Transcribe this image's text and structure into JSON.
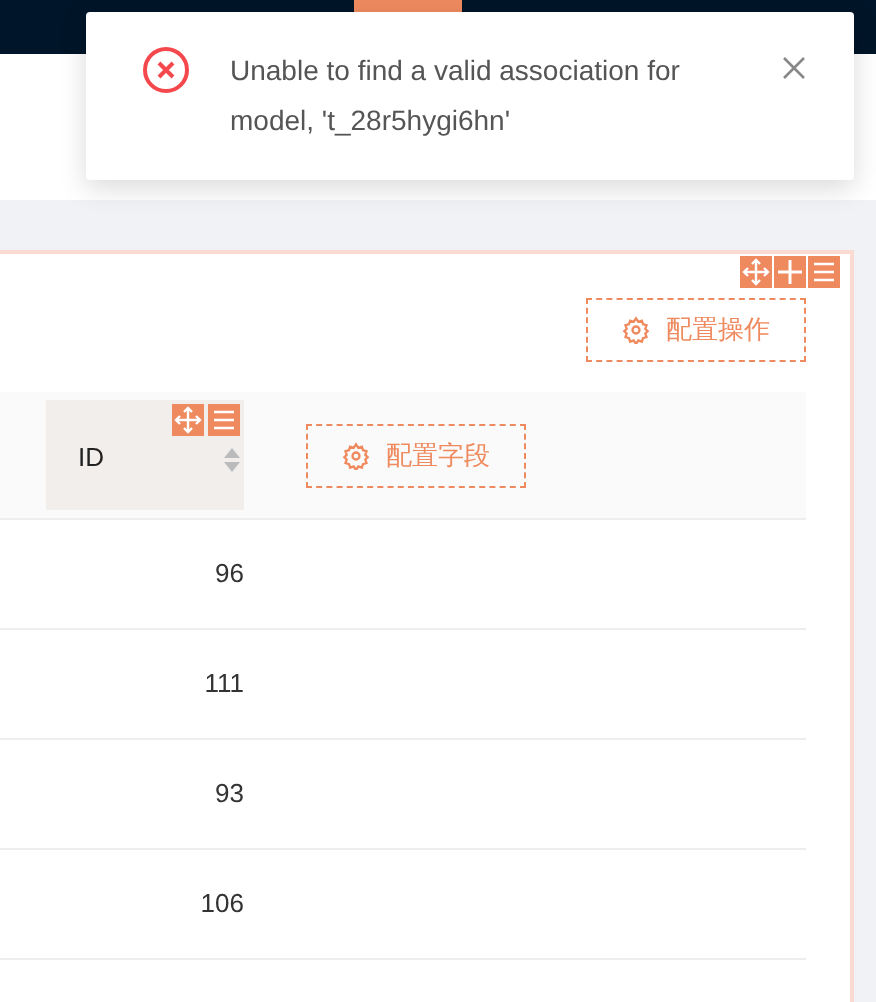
{
  "toast": {
    "message": "Unable to find a valid association for model, 't_28r5hygi6hn'"
  },
  "toolbar": {
    "button": "配置操作"
  },
  "table": {
    "columns": [
      {
        "label": "ID",
        "sortable": true
      }
    ],
    "config_button": "配置字段",
    "rows": [
      {
        "id": "96"
      },
      {
        "id": "111"
      },
      {
        "id": "93"
      },
      {
        "id": "106"
      }
    ]
  }
}
